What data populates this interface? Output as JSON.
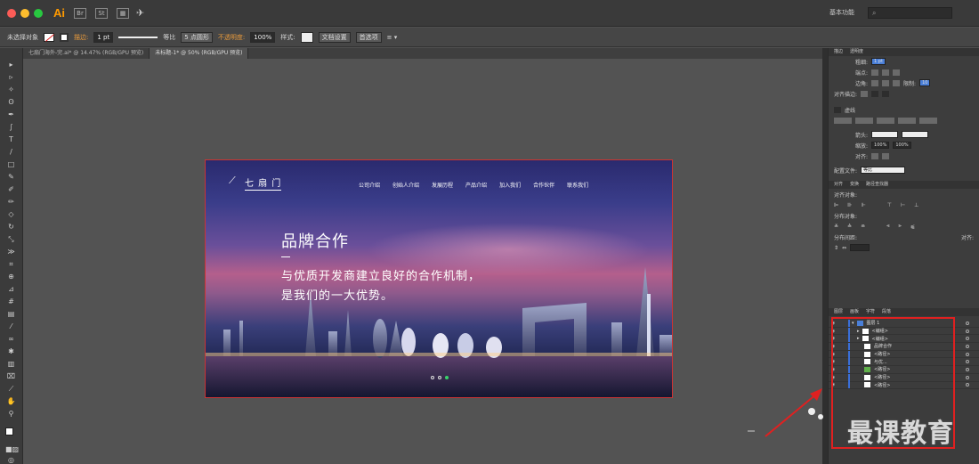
{
  "menubar": {
    "app_logo": "Ai",
    "workspace_label": "基本功能",
    "search_placeholder": "",
    "traffic_colors": [
      "#fc5c57",
      "#fdbd2e",
      "#28c840"
    ]
  },
  "control_bar": {
    "selection_label": "未选择对象",
    "stroke_label": "描边:",
    "stroke_weight": "1 pt",
    "uniform_label": "等比",
    "brush_label": "5 点圆形",
    "opacity_label": "不透明度:",
    "opacity_value": "100%",
    "style_label": "样式:",
    "doc_setup_button": "文档设置",
    "prefs_button": "首选项"
  },
  "tabs": [
    {
      "label": "七扇门海外-完.ai* @ 14.47% (RGB/GPU 预览)",
      "active": false
    },
    {
      "label": "未标题-1* @ 50% (RGB/GPU 预览)",
      "active": true
    }
  ],
  "artboard": {
    "logo_text": "七 扇 门",
    "nav": [
      "公司介绍",
      "创始人介绍",
      "发展历程",
      "产品介绍",
      "加入我们",
      "合作伙伴",
      "联系我们"
    ],
    "headline": "品牌合作",
    "dash": "—",
    "line1": "与优质开发商建立良好的合作机制，",
    "line2": "是我们的一大优势。"
  },
  "stroke_panel": {
    "tabs": [
      "描边",
      "透明度"
    ],
    "weight_label": "粗细:",
    "weight_value": "1 pt",
    "cap_label": "端点:",
    "corner_label": "边角:",
    "limit_label": "限制:",
    "limit_value": "10",
    "align_label": "对齐描边:",
    "dash_label": "虚线",
    "arrow_label": "箭头:",
    "scale_label": "缩放:",
    "scale_a": "100%",
    "scale_b": "100%",
    "align_row_label": "对齐:",
    "profile_label": "配置文件:",
    "profile_value": "等比"
  },
  "align_panel": {
    "tabs": [
      "对齐",
      "变换",
      "路径查找器"
    ],
    "align_objects": "对齐对象:",
    "distribute_objects": "分布对象:",
    "distribute_spacing": "分布间距:",
    "align_to": "对齐:"
  },
  "layers_panel": {
    "tabs": [
      "图层",
      "画板",
      "字符",
      "段落"
    ],
    "rows": [
      {
        "name": "图层 1",
        "thumb": "layer"
      },
      {
        "name": "<编组>",
        "thumb": "white"
      },
      {
        "name": "<编组>",
        "thumb": "white"
      },
      {
        "name": "品牌合作",
        "thumb": "white"
      },
      {
        "name": "<路径>",
        "thumb": "white"
      },
      {
        "name": "与优...",
        "thumb": "white"
      },
      {
        "name": "<路径>",
        "thumb": "green"
      },
      {
        "name": "<路径>",
        "thumb": "white"
      },
      {
        "name": "<路径>",
        "thumb": "white"
      }
    ]
  },
  "watermark": "最课教育",
  "colors": {
    "highlight_box": "#e02020",
    "accent_orange": "#ff9a00",
    "active_dot": "#39d36a"
  }
}
